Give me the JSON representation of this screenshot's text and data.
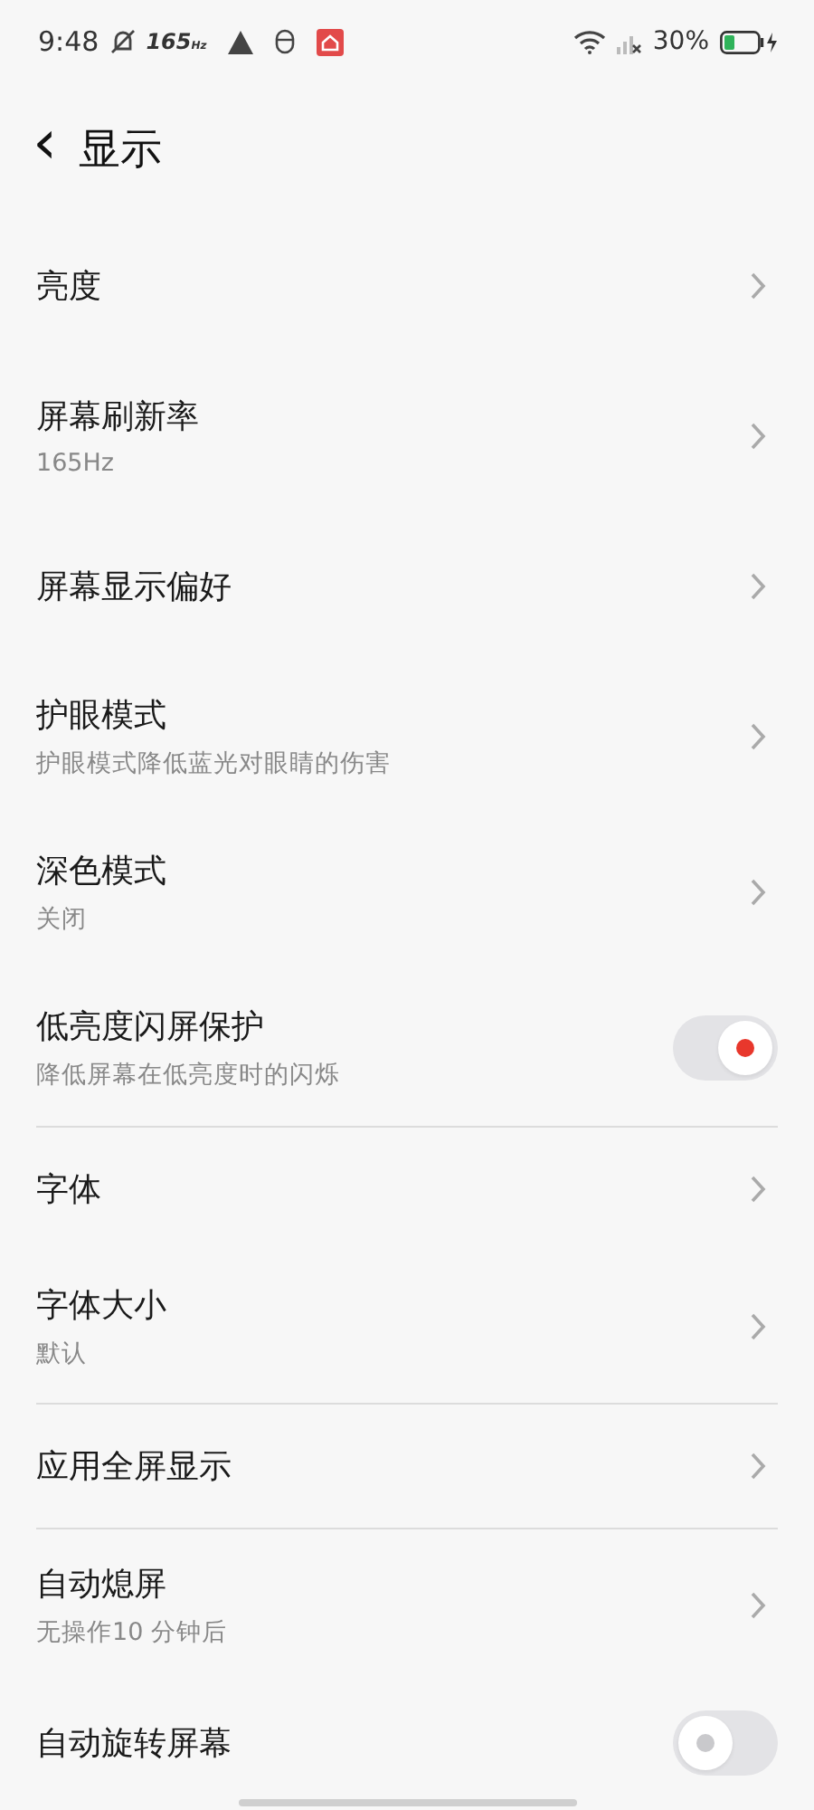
{
  "status_bar": {
    "time": "9:48",
    "refresh_rate": "165$_{Hz}$",
    "battery": "30%"
  },
  "header": {
    "back": "‹",
    "title": "显示"
  },
  "groups": [
    {
      "items": [
        {
          "kind": "link",
          "title": "亮度"
        },
        {
          "kind": "link",
          "title": "屏幕刷新率",
          "subtitle": "165Hz"
        },
        {
          "kind": "link",
          "title": "屏幕显示偏好"
        },
        {
          "kind": "link",
          "title": "护眼模式",
          "subtitle": "护眼模式降低蓝光对眼睛的伤害"
        },
        {
          "kind": "link",
          "title": "深色模式",
          "subtitle": "关闭"
        },
        {
          "kind": "toggle",
          "title": "低亮度闪屏保护",
          "subtitle": "降低屏幕在低亮度时的闪烁",
          "on": true
        }
      ]
    },
    {
      "items": [
        {
          "kind": "link",
          "title": "字体"
        },
        {
          "kind": "link",
          "title": "字体大小",
          "subtitle": "默认"
        }
      ]
    },
    {
      "items": [
        {
          "kind": "link",
          "title": "应用全屏显示"
        }
      ]
    },
    {
      "items": [
        {
          "kind": "link",
          "title": "自动熄屏",
          "subtitle": "无操作10 分钟后"
        },
        {
          "kind": "toggle",
          "title": "自动旋转屏幕",
          "on": false
        }
      ]
    }
  ]
}
